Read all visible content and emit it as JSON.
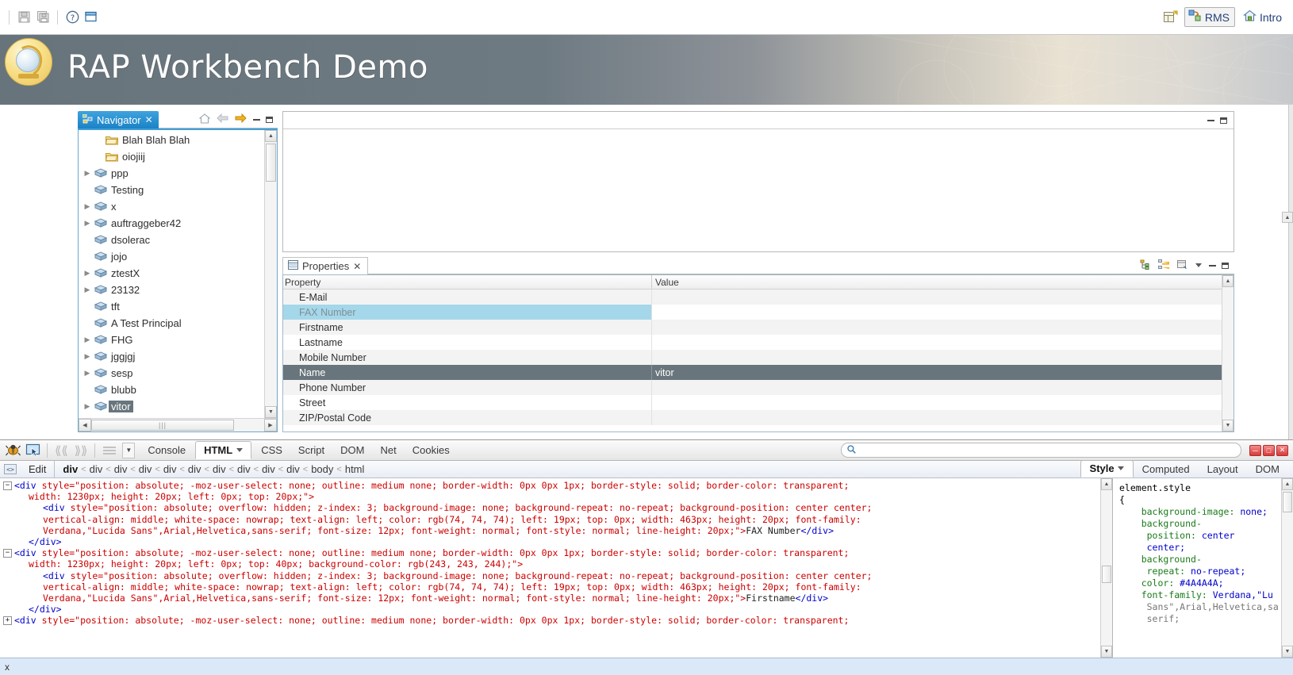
{
  "top_toolbar": {
    "icons": [
      {
        "name": "save-icon",
        "label": "Save"
      },
      {
        "name": "save-all-icon",
        "label": "Save All"
      },
      {
        "name": "help-icon",
        "label": "Help"
      },
      {
        "name": "restore-icon",
        "label": "Restore Window"
      }
    ],
    "open_perspective_icon": "open-perspective-icon",
    "perspective_label": "RMS",
    "intro_label": "Intro"
  },
  "banner": {
    "title": "RAP Workbench Demo",
    "logo_icon": "globe-icon"
  },
  "navigator": {
    "tab_label": "Navigator",
    "tab_icon": "navigator-icon",
    "close_icon": "close-icon",
    "toolbar_icons": [
      "home-icon",
      "back-arrow-icon",
      "forward-arrow-icon"
    ],
    "minimize_icon": "minimize-icon",
    "maximize_icon": "maximize-icon",
    "items": [
      {
        "label": "Blah Blah Blah",
        "icon": "folder-icon",
        "expandable": false,
        "indent": 1,
        "selected": false
      },
      {
        "label": "oiojiij",
        "icon": "folder-icon",
        "expandable": false,
        "indent": 1,
        "selected": false
      },
      {
        "label": "ppp",
        "icon": "book-icon",
        "expandable": true,
        "indent": 0,
        "selected": false
      },
      {
        "label": "Testing",
        "icon": "book-icon",
        "expandable": false,
        "indent": 0,
        "selected": false
      },
      {
        "label": "x",
        "icon": "book-icon",
        "expandable": true,
        "indent": 0,
        "selected": false
      },
      {
        "label": "auftraggeber42",
        "icon": "book-icon",
        "expandable": true,
        "indent": 0,
        "selected": false
      },
      {
        "label": "dsolerac",
        "icon": "book-icon",
        "expandable": false,
        "indent": 0,
        "selected": false
      },
      {
        "label": "jojo",
        "icon": "book-icon",
        "expandable": false,
        "indent": 0,
        "selected": false
      },
      {
        "label": "ztestX",
        "icon": "book-icon",
        "expandable": true,
        "indent": 0,
        "selected": false
      },
      {
        "label": "23132",
        "icon": "book-icon",
        "expandable": true,
        "indent": 0,
        "selected": false
      },
      {
        "label": "tft",
        "icon": "book-icon",
        "expandable": false,
        "indent": 0,
        "selected": false
      },
      {
        "label": "A Test Principal",
        "icon": "book-icon",
        "expandable": false,
        "indent": 0,
        "selected": false
      },
      {
        "label": "FHG",
        "icon": "book-icon",
        "expandable": true,
        "indent": 0,
        "selected": false
      },
      {
        "label": "jggjgj",
        "icon": "book-icon",
        "expandable": true,
        "indent": 0,
        "selected": false
      },
      {
        "label": "sesp",
        "icon": "book-icon",
        "expandable": true,
        "indent": 0,
        "selected": false
      },
      {
        "label": "blubb",
        "icon": "book-icon",
        "expandable": false,
        "indent": 0,
        "selected": false
      },
      {
        "label": "vitor",
        "icon": "book-icon",
        "expandable": true,
        "indent": 0,
        "selected": true
      }
    ]
  },
  "properties": {
    "tab_label": "Properties",
    "tab_icon": "properties-icon",
    "close_icon": "close-icon",
    "toolbar_icons": [
      "show-categories-icon",
      "show-advanced-icon",
      "restore-default-icon",
      "view-menu-icon"
    ],
    "minimize_icon": "minimize-icon",
    "maximize_icon": "maximize-icon",
    "columns": [
      "Property",
      "Value"
    ],
    "rows": [
      {
        "property": "E-Mail",
        "value": "",
        "state": "alt"
      },
      {
        "property": "FAX Number",
        "value": "",
        "state": "hilite"
      },
      {
        "property": "Firstname",
        "value": "",
        "state": "alt"
      },
      {
        "property": "Lastname",
        "value": "",
        "state": "normal"
      },
      {
        "property": "Mobile Number",
        "value": "",
        "state": "alt"
      },
      {
        "property": "Name",
        "value": "vitor",
        "state": "sel"
      },
      {
        "property": "Phone Number",
        "value": "",
        "state": "alt"
      },
      {
        "property": "Street",
        "value": "",
        "state": "normal"
      },
      {
        "property": "ZIP/Postal Code",
        "value": "",
        "state": "alt"
      }
    ]
  },
  "firebug": {
    "toolbar": {
      "bug_icon": "firebug-bug-icon",
      "inspect_icon": "inspect-pointer-icon",
      "prev_icon": "previous-icon",
      "next_icon": "next-icon",
      "menu_icon": "menu-lines-icon",
      "dropdown_icon": "chevron-down-icon",
      "tabs": [
        {
          "label": "Console",
          "active": false,
          "has_dropdown": false
        },
        {
          "label": "HTML",
          "active": true,
          "has_dropdown": true
        },
        {
          "label": "CSS",
          "active": false,
          "has_dropdown": false
        },
        {
          "label": "Script",
          "active": false,
          "has_dropdown": false
        },
        {
          "label": "DOM",
          "active": false,
          "has_dropdown": false
        },
        {
          "label": "Net",
          "active": false,
          "has_dropdown": false
        },
        {
          "label": "Cookies",
          "active": false,
          "has_dropdown": false
        }
      ],
      "search_placeholder": "",
      "search_value": "",
      "search_icon": "search-icon",
      "window_controls": [
        "minimize-icon",
        "maximize-icon",
        "close-icon"
      ]
    },
    "secondrow": {
      "inspect_icon": "source-toggle-icon",
      "edit_label": "Edit",
      "breadcrumb": [
        "div",
        "div",
        "div",
        "div",
        "div",
        "div",
        "div",
        "div",
        "div",
        "div",
        "body",
        "html"
      ],
      "breadcrumb_separator": "<",
      "right_tabs": [
        {
          "label": "Style",
          "active": true,
          "has_dropdown": true
        },
        {
          "label": "Computed",
          "active": false,
          "has_dropdown": false
        },
        {
          "label": "Layout",
          "active": false,
          "has_dropdown": false
        },
        {
          "label": "DOM",
          "active": false,
          "has_dropdown": false
        }
      ]
    },
    "html_source": [
      {
        "indent": 0,
        "twisty": "minus",
        "segments": [
          {
            "t": "tag",
            "v": "<div "
          },
          {
            "t": "attr",
            "v": "style=\"position: absolute; -moz-user-select: none; outline: medium none; border-width: 0px 0px 1px; border-style: solid; border-color: transparent;"
          }
        ]
      },
      {
        "indent": 1,
        "twisty": "",
        "segments": [
          {
            "t": "attr",
            "v": "width: 1230px; height: 20px; left: 0px; top: 20px;\">"
          }
        ]
      },
      {
        "indent": 2,
        "twisty": "",
        "segments": [
          {
            "t": "tag",
            "v": "<div "
          },
          {
            "t": "attr",
            "v": "style=\"position: absolute; overflow: hidden; z-index: 3; background-image: none; background-repeat: no-repeat; background-position: center center;"
          }
        ]
      },
      {
        "indent": 2,
        "twisty": "",
        "segments": [
          {
            "t": "attr",
            "v": "vertical-align: middle; white-space: nowrap; text-align: left; color: rgb(74, 74, 74); left: 19px; top: 0px; width: 463px; height: 20px; font-family:"
          }
        ]
      },
      {
        "indent": 2,
        "twisty": "",
        "segments": [
          {
            "t": "attr",
            "v": "Verdana,\"Lucida Sans\",Arial,Helvetica,sans-serif; font-size: 12px; font-weight: normal; font-style: normal; line-height: 20px;\">"
          },
          {
            "t": "txt",
            "v": "FAX Number"
          },
          {
            "t": "tag",
            "v": "</div>"
          }
        ]
      },
      {
        "indent": 1,
        "twisty": "",
        "segments": [
          {
            "t": "tag",
            "v": "</div>"
          }
        ]
      },
      {
        "indent": 0,
        "twisty": "minus",
        "segments": [
          {
            "t": "tag",
            "v": "<div "
          },
          {
            "t": "attr",
            "v": "style=\"position: absolute; -moz-user-select: none; outline: medium none; border-width: 0px 0px 1px; border-style: solid; border-color: transparent;"
          }
        ]
      },
      {
        "indent": 1,
        "twisty": "",
        "segments": [
          {
            "t": "attr",
            "v": "width: 1230px; height: 20px; left: 0px; top: 40px; background-color: rgb(243, 243, 244);\">"
          }
        ]
      },
      {
        "indent": 2,
        "twisty": "",
        "segments": [
          {
            "t": "tag",
            "v": "<div "
          },
          {
            "t": "attr",
            "v": "style=\"position: absolute; overflow: hidden; z-index: 3; background-image: none; background-repeat: no-repeat; background-position: center center;"
          }
        ]
      },
      {
        "indent": 2,
        "twisty": "",
        "segments": [
          {
            "t": "attr",
            "v": "vertical-align: middle; white-space: nowrap; text-align: left; color: rgb(74, 74, 74); left: 19px; top: 0px; width: 463px; height: 20px; font-family:"
          }
        ]
      },
      {
        "indent": 2,
        "twisty": "",
        "segments": [
          {
            "t": "attr",
            "v": "Verdana,\"Lucida Sans\",Arial,Helvetica,sans-serif; font-size: 12px; font-weight: normal; font-style: normal; line-height: 20px;\">"
          },
          {
            "t": "txt",
            "v": "Firstname"
          },
          {
            "t": "tag",
            "v": "</div>"
          }
        ]
      },
      {
        "indent": 1,
        "twisty": "",
        "segments": [
          {
            "t": "tag",
            "v": "</div>"
          }
        ]
      },
      {
        "indent": 0,
        "twisty": "plus",
        "segments": [
          {
            "t": "tag",
            "v": "<div "
          },
          {
            "t": "attr",
            "v": "style=\"position: absolute; -moz-user-select: none; outline: medium none; border-width: 0px 0px 1px; border-style: solid; border-color: transparent;"
          }
        ]
      }
    ],
    "style_panel": {
      "lines": [
        [
          {
            "t": "sel",
            "v": "element.style"
          }
        ],
        [
          {
            "t": "sel",
            "v": "{"
          }
        ],
        [
          {
            "t": "prop",
            "v": "    background-image: "
          },
          {
            "t": "val",
            "v": "none;"
          }
        ],
        [
          {
            "t": "prop",
            "v": "    background-"
          }
        ],
        [
          {
            "t": "prop",
            "v": "     position: "
          },
          {
            "t": "val",
            "v": "center"
          }
        ],
        [
          {
            "t": "val",
            "v": "     center;"
          }
        ],
        [
          {
            "t": "prop",
            "v": "    background-"
          }
        ],
        [
          {
            "t": "prop",
            "v": "     repeat: "
          },
          {
            "t": "val",
            "v": "no-repeat;"
          }
        ],
        [
          {
            "t": "prop",
            "v": "    color: "
          },
          {
            "t": "val",
            "v": "#4A4A4A;"
          }
        ],
        [
          {
            "t": "prop",
            "v": "    font-family: "
          },
          {
            "t": "val",
            "v": "Verdana,\"Lu"
          }
        ],
        [
          {
            "t": "val2",
            "v": "     Sans\",Arial,Helvetica,sa"
          }
        ],
        [
          {
            "t": "val2",
            "v": "     serif;"
          }
        ]
      ]
    },
    "status_bar": {
      "close_label": "x"
    }
  }
}
